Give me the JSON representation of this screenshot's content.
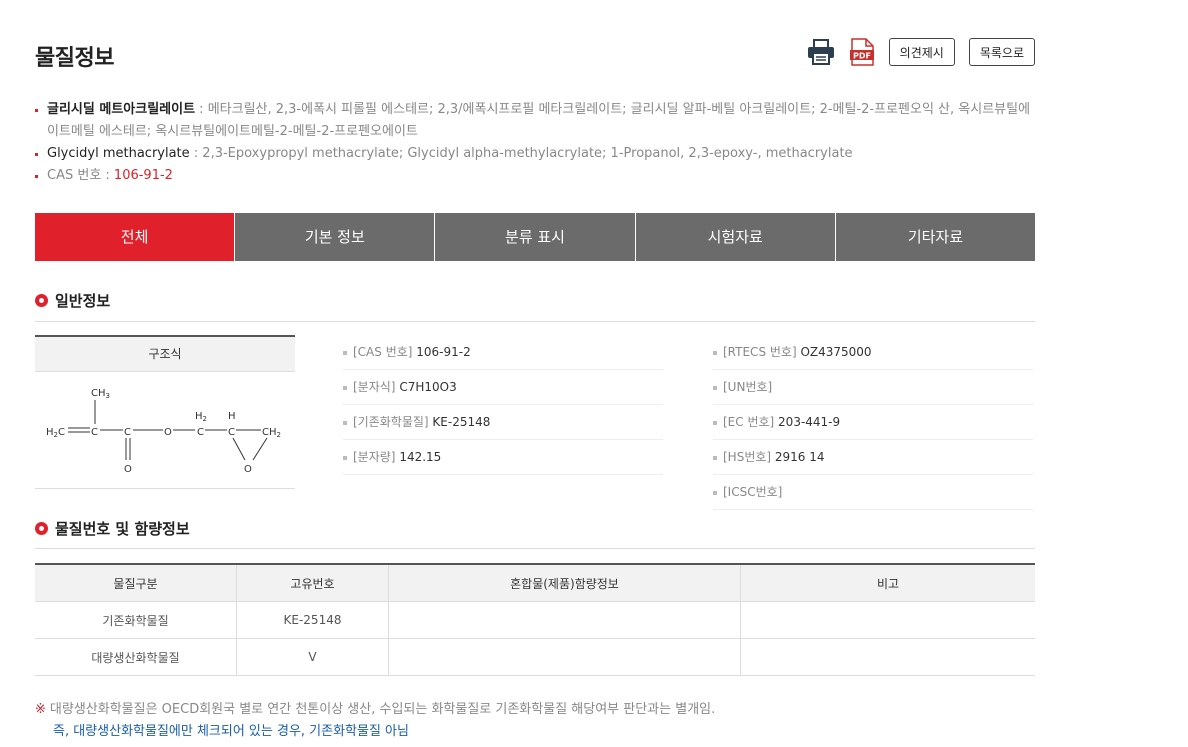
{
  "page": {
    "title": "물질정보"
  },
  "actions": {
    "print_icon": "print-icon",
    "pdf_icon": "pdf-icon",
    "pdf_label": "PDF",
    "opinion_label": "의견제시",
    "list_label": "목록으로"
  },
  "names": {
    "kr_name": "글리시딜 메트아크릴레이트",
    "kr_synonyms": " : 메타크릴산, 2,3-에폭시 피롤필 에스테르; 2,3/에폭시프로필 메타크릴레이트; 글리시딜 알파-베틸 아크릴레이트; 2-메틸-2-프로펜오익 산, 옥시르뷰틸에이트메틸 에스테르; 옥시르뷰틸에이트메틸-2-메틸-2-프로펜오에이트",
    "en_name": "Glycidyl methacrylate",
    "en_synonyms": " : 2,3-Epoxypropyl methacrylate; Glycidyl alpha-methylacrylate; 1-Propanol, 2,3-epoxy-, methacrylate",
    "cas_label": "CAS 번호 : ",
    "cas_value": "106-91-2"
  },
  "tabs": [
    "전체",
    "기본 정보",
    "분류 표시",
    "시험자료",
    "기타자료"
  ],
  "general": {
    "title": "일반정보",
    "structure_header": "구조식",
    "structure": {
      "ch3": "CH",
      "ch3_sub": "3",
      "h2c": "H",
      "h2c_sub": "2",
      "h2c_c": "C",
      "c1": "C",
      "c2": "C",
      "o_carbonyl": "O",
      "o_ester": "O",
      "ch2a": "H",
      "ch2a_sub": "2",
      "ch2a_c": "C",
      "ch": "H",
      "ch_c": "C",
      "ch2b": "CH",
      "ch2b_sub": "2",
      "o_epoxy": "O"
    },
    "left_items": [
      {
        "k": "[CAS 번호] ",
        "v": "106-91-2"
      },
      {
        "k": "[분자식] ",
        "v": "C7H10O3"
      },
      {
        "k": "[기존화학물질] ",
        "v": "KE-25148"
      },
      {
        "k": "[분자량] ",
        "v": "142.15"
      }
    ],
    "right_items": [
      {
        "k": "[RTECS 번호] ",
        "v": "OZ4375000"
      },
      {
        "k": "[UN번호]",
        "v": ""
      },
      {
        "k": "[EC 번호] ",
        "v": "203-441-9"
      },
      {
        "k": "[HS번호] ",
        "v": "2916 14"
      },
      {
        "k": "[ICSC번호]",
        "v": ""
      }
    ]
  },
  "substance": {
    "title": "물질번호 및 함량정보",
    "headers": [
      "물질구분",
      "고유번호",
      "혼합물(제품)함량정보",
      "비고"
    ],
    "rows": [
      [
        "기존화학물질",
        "KE-25148",
        "",
        ""
      ],
      [
        "대량생산화학물질",
        "V",
        "",
        ""
      ]
    ]
  },
  "note": {
    "mark": "※",
    "line1": "대량생산화학물질은 OECD회원국 별로 연간 천톤이상 생산, 수입되는 화학물질로 기존화학물질 해당여부 판단과는 별개임.",
    "line2": "즉, 대량생산화학물질에만 체크되어 있는 경우, 기존화학물질 아님"
  }
}
